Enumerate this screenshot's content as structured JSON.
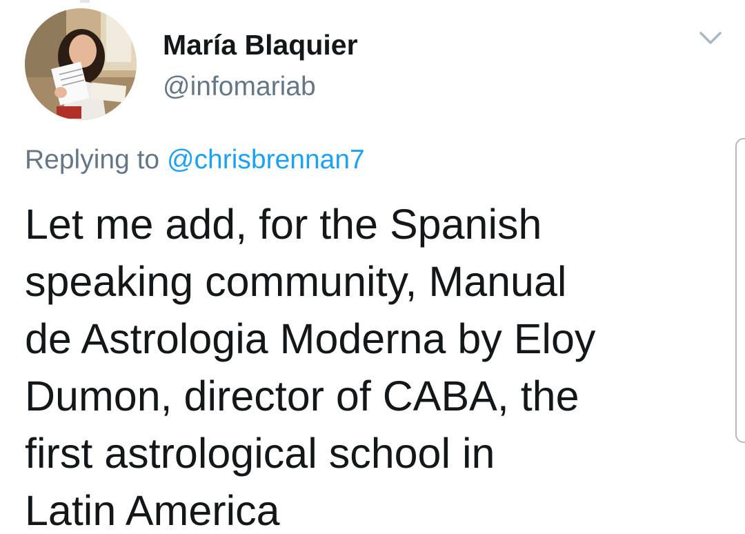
{
  "author": {
    "display_name": "María Blaquier",
    "handle": "@infomariab"
  },
  "reply": {
    "prefix": "Replying to ",
    "mention": "@chrisbrennan7"
  },
  "tweet": {
    "lines": [
      "Let me add, for the Spanish",
      "speaking community, Manual",
      "de Astrologia Moderna by Eloy",
      "Dumon, director of CABA, the",
      "first astrological school in",
      "Latin America"
    ]
  },
  "icons": {
    "menu": "chevron-down-icon",
    "avatar": "profile-photo"
  },
  "colors": {
    "text": "#14171a",
    "secondary": "#657786",
    "link": "#1da1f2",
    "chevron": "#aab8c2"
  }
}
